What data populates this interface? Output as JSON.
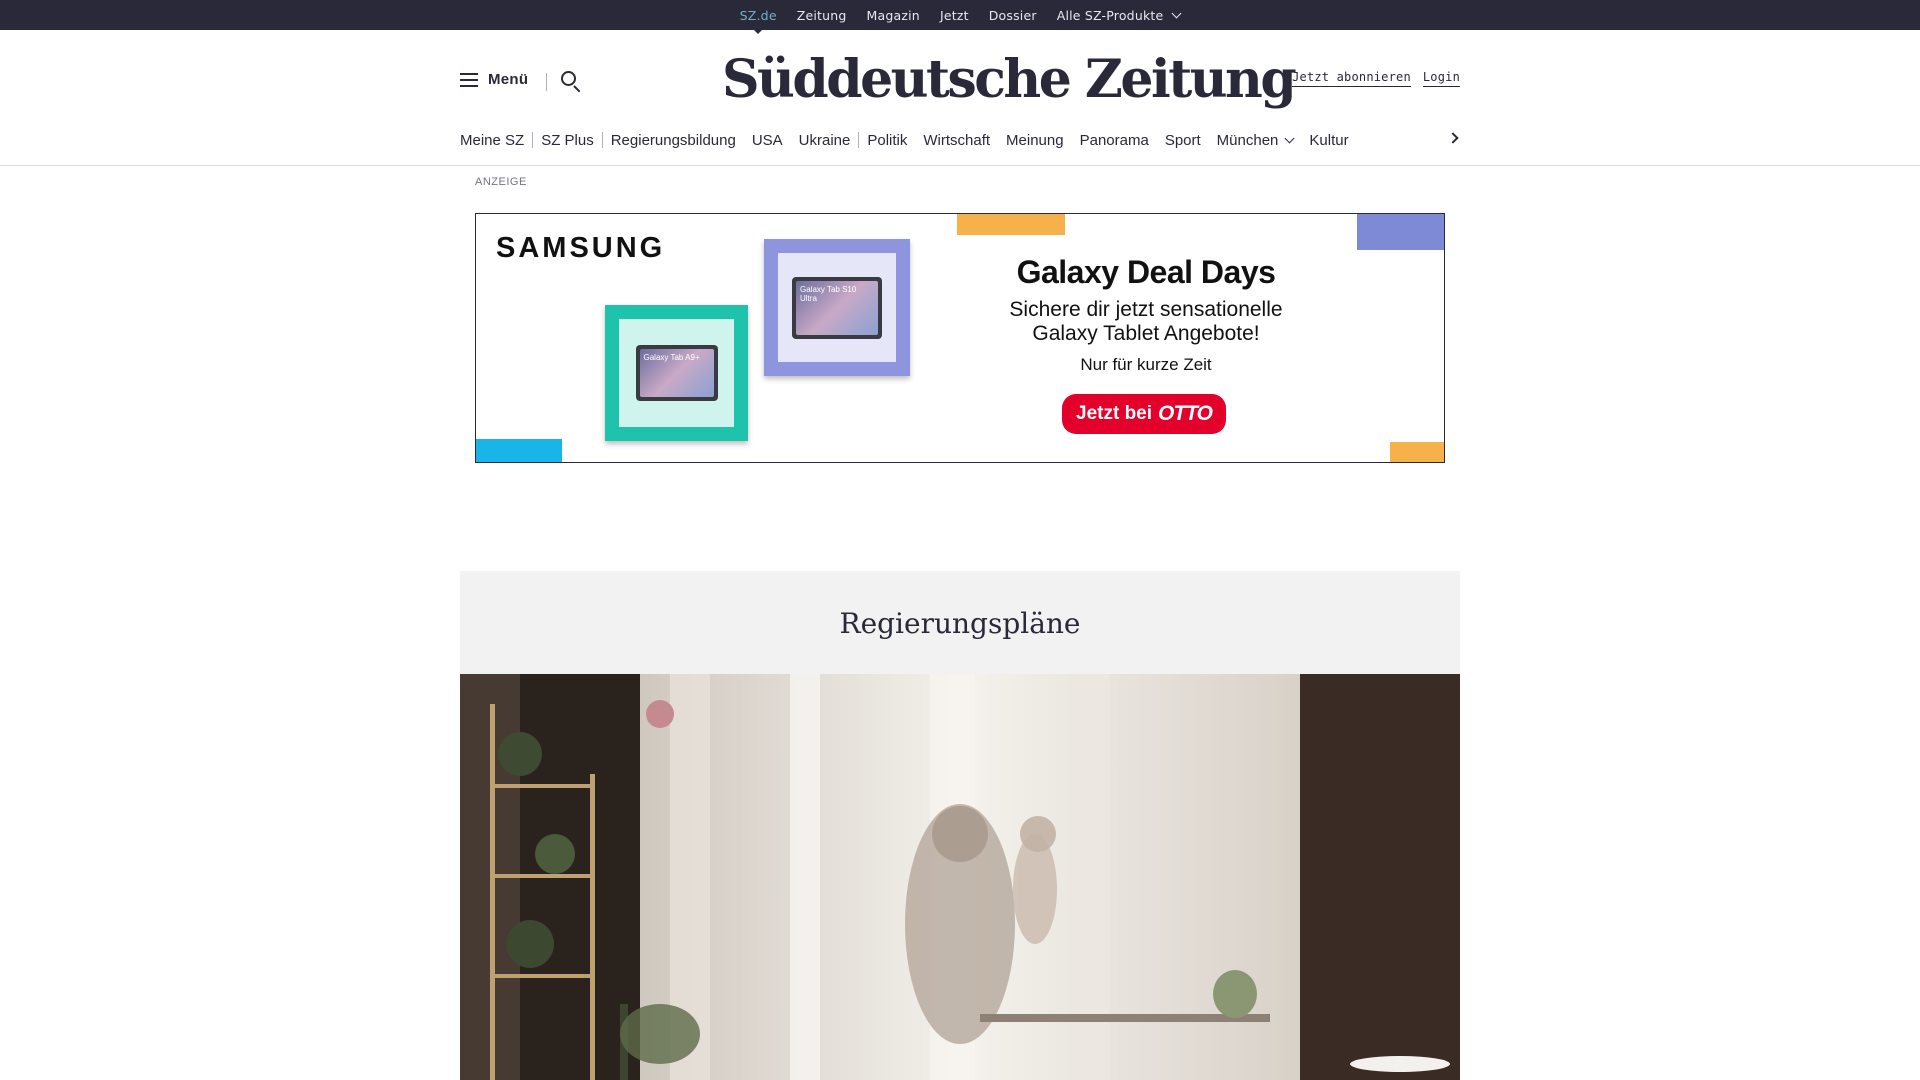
{
  "topbar": {
    "links": [
      "SZ.de",
      "Zeitung",
      "Magazin",
      "Jetzt",
      "Dossier",
      "Alle SZ-Produkte"
    ]
  },
  "header": {
    "menu_label": "Menü",
    "logo": "Süddeutsche Zeitung",
    "subscribe": "Jetzt abonnieren",
    "login": "Login"
  },
  "nav": {
    "items": [
      "Meine SZ",
      "SZ Plus",
      "Regierungsbildung",
      "USA",
      "Ukraine",
      "Politik",
      "Wirtschaft",
      "Meinung",
      "Panorama",
      "Sport",
      "München",
      "Kultur"
    ]
  },
  "ad": {
    "label": "ANZEIGE",
    "brand": "SAMSUNG",
    "tablet_a": "Galaxy Tab A9+",
    "tablet_b": "Galaxy Tab S10 Ultra",
    "headline": "Galaxy Deal Days",
    "sub_line1": "Sichere dir jetzt sensationelle",
    "sub_line2": "Galaxy Tablet Angebote!",
    "small": "Nur für kurze Zeit",
    "cta_prefix": "Jetzt bei",
    "cta_brand": "OTTO",
    "colors": {
      "cta": "#e3002b",
      "teal": "#1fc2ab",
      "purple": "#8e94de",
      "orange": "#f7b14b",
      "blue": "#18b5e8"
    }
  },
  "section": {
    "title": "Regierungspläne"
  },
  "icons": [
    "hamburger-icon",
    "search-icon",
    "chevron-down-icon",
    "chevron-right-icon"
  ]
}
